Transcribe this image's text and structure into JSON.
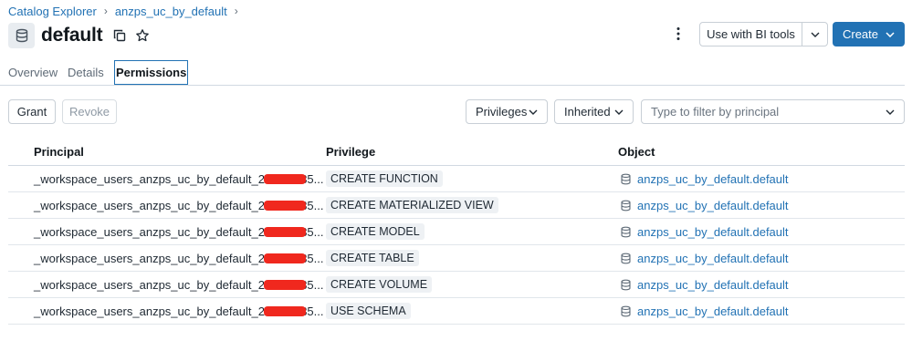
{
  "breadcrumb": {
    "items": [
      "Catalog Explorer",
      "anzps_uc_by_default"
    ],
    "separator": "›"
  },
  "header": {
    "title": "default",
    "copy_icon": "copy-icon",
    "star_icon": "star-icon",
    "badge_icon": "database-icon"
  },
  "actions": {
    "more_icon": "kebab-icon",
    "bi_label": "Use with BI tools",
    "create_label": "Create"
  },
  "tabs": [
    {
      "label": "Overview"
    },
    {
      "label": "Details"
    },
    {
      "label": "Permissions",
      "active": true
    }
  ],
  "toolbar": {
    "grant_label": "Grant",
    "revoke_label": "Revoke",
    "privileges_label": "Privileges",
    "inherited_label": "Inherited",
    "filter_placeholder": "Type to filter by principal"
  },
  "table": {
    "headers": {
      "principal": "Principal",
      "privilege": "Privilege",
      "object": "Object"
    },
    "rows": [
      {
        "principal_prefix": "_workspace_users_anzps_uc_by_default_25",
        "principal_suffix": "35...",
        "privilege": "CREATE FUNCTION",
        "object": "anzps_uc_by_default.default"
      },
      {
        "principal_prefix": "_workspace_users_anzps_uc_by_default_25",
        "principal_suffix": "35...",
        "privilege": "CREATE MATERIALIZED VIEW",
        "object": "anzps_uc_by_default.default"
      },
      {
        "principal_prefix": "_workspace_users_anzps_uc_by_default_25",
        "principal_suffix": "35...",
        "privilege": "CREATE MODEL",
        "object": "anzps_uc_by_default.default"
      },
      {
        "principal_prefix": "_workspace_users_anzps_uc_by_default_25",
        "principal_suffix": "35...",
        "privilege": "CREATE TABLE",
        "object": "anzps_uc_by_default.default"
      },
      {
        "principal_prefix": "_workspace_users_anzps_uc_by_default_25",
        "principal_suffix": "35...",
        "privilege": "CREATE VOLUME",
        "object": "anzps_uc_by_default.default"
      },
      {
        "principal_prefix": "_workspace_users_anzps_uc_by_default_25",
        "principal_suffix": "35...",
        "privilege": "USE SCHEMA",
        "object": "anzps_uc_by_default.default"
      }
    ]
  },
  "colors": {
    "accent": "#2272b4",
    "redaction": "#f0281e"
  }
}
